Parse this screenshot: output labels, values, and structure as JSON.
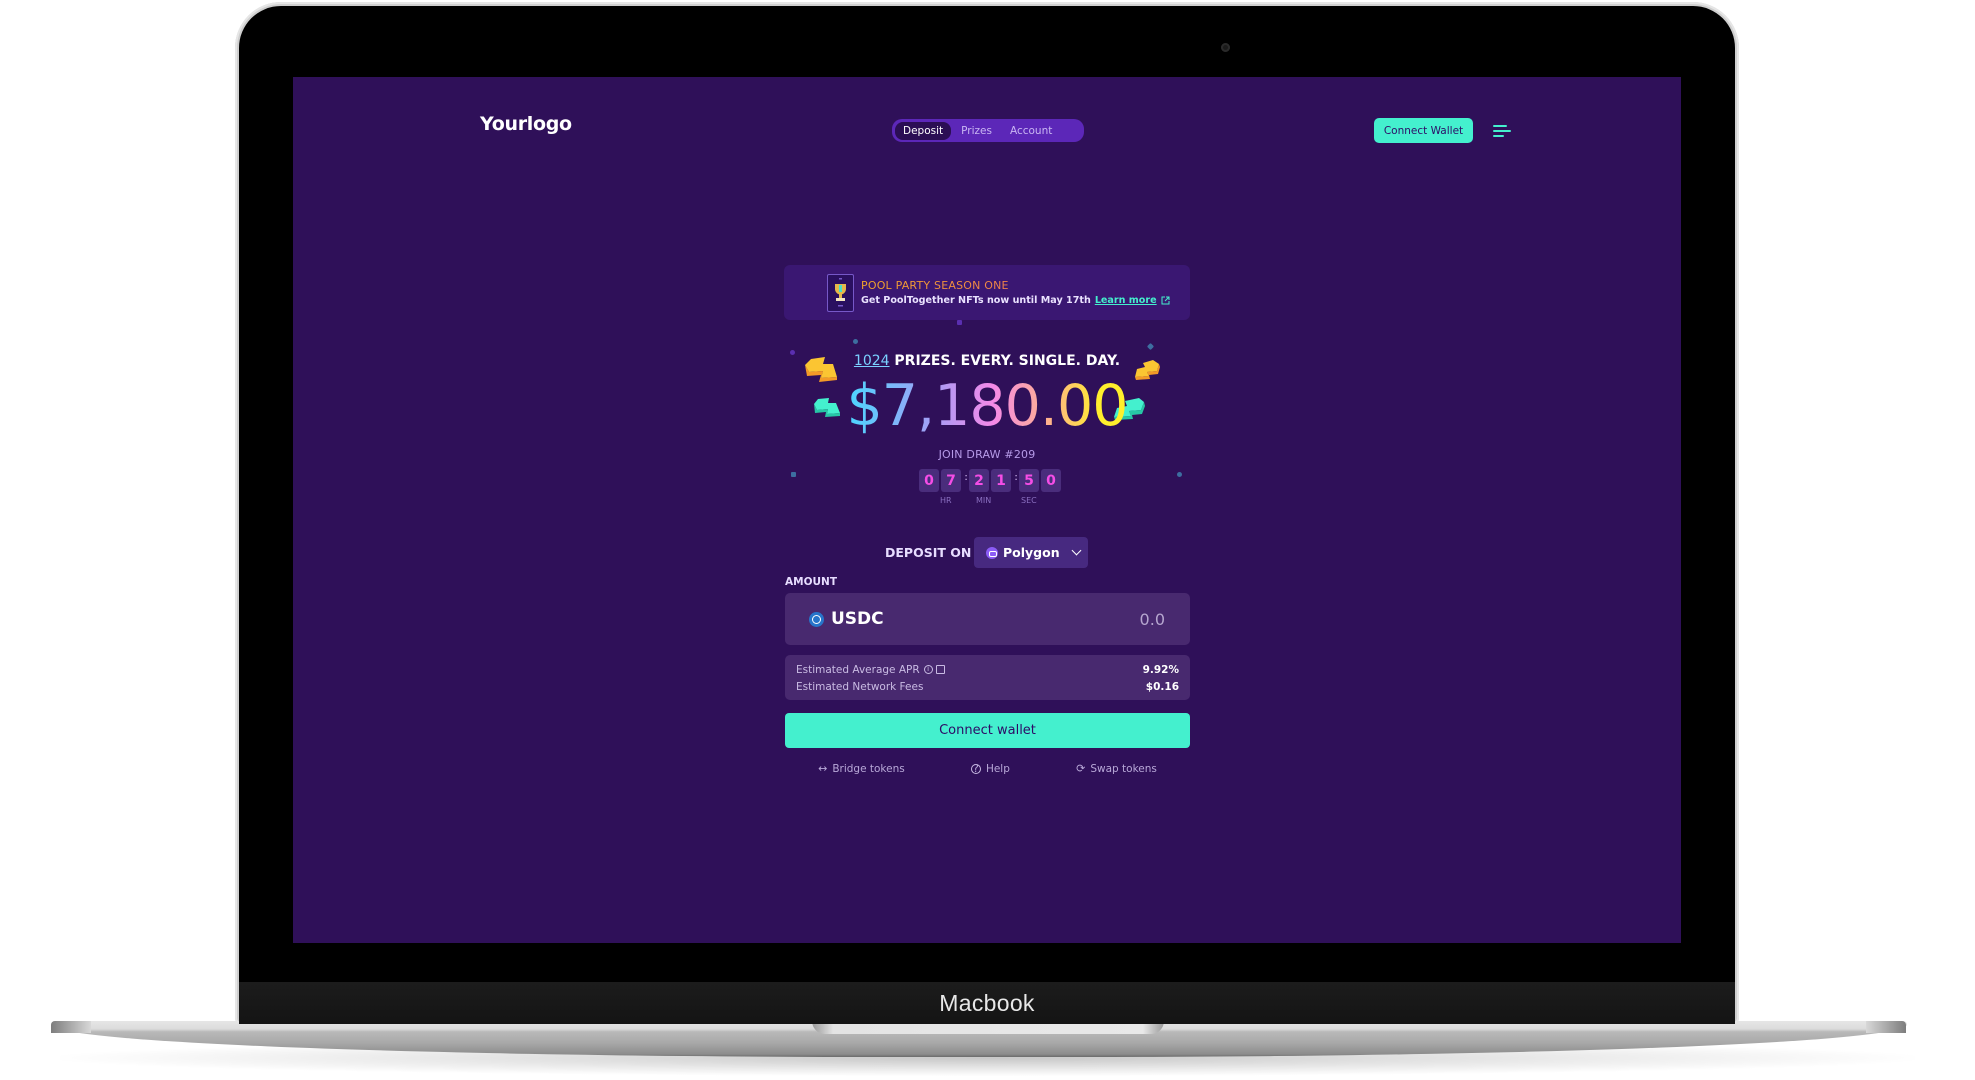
{
  "device": {
    "bezel_label": "Macbook"
  },
  "header": {
    "logo": "Yourlogo",
    "tabs": [
      {
        "label": "Deposit",
        "active": true
      },
      {
        "label": "Prizes",
        "active": false
      },
      {
        "label": "Account",
        "active": false
      }
    ],
    "connect_wallet_label": "Connect Wallet",
    "menu_icon": "hamburger-icon"
  },
  "banner": {
    "title": "POOL PARTY SEASON ONE",
    "subtitle": "Get PoolTogether NFTs now until May 17th",
    "link_label": "Learn more",
    "icon": "trophy-nft-card"
  },
  "prizes": {
    "count": "1024",
    "tagline": "PRIZES. EVERY. SINGLE. DAY.",
    "amount": "$7,180.00"
  },
  "draw": {
    "label": "JOIN DRAW #209",
    "hours": [
      "0",
      "7"
    ],
    "minutes": [
      "2",
      "1"
    ],
    "seconds": [
      "5",
      "0"
    ],
    "hr_label": "HR",
    "min_label": "MIN",
    "sec_label": "SEC"
  },
  "deposit": {
    "deposit_on_label": "DEPOSIT ON",
    "network": "Polygon",
    "amount_label": "AMOUNT",
    "token": "USDC",
    "amount_placeholder": "0.0",
    "stats": [
      {
        "label": "Estimated Average APR",
        "value": "9.92%"
      },
      {
        "label": "Estimated Network Fees",
        "value": "$0.16"
      }
    ],
    "connect_wallet_label": "Connect wallet"
  },
  "links": [
    {
      "label": "Bridge tokens",
      "icon": "↔"
    },
    {
      "label": "Help",
      "icon": "?"
    },
    {
      "label": "Swap tokens",
      "icon": "⟳"
    }
  ],
  "colors": {
    "background": "#2f1059",
    "accent": "#44f0ce",
    "nav_pill": "#5c27b8",
    "timer_digit": "#f54de6"
  }
}
